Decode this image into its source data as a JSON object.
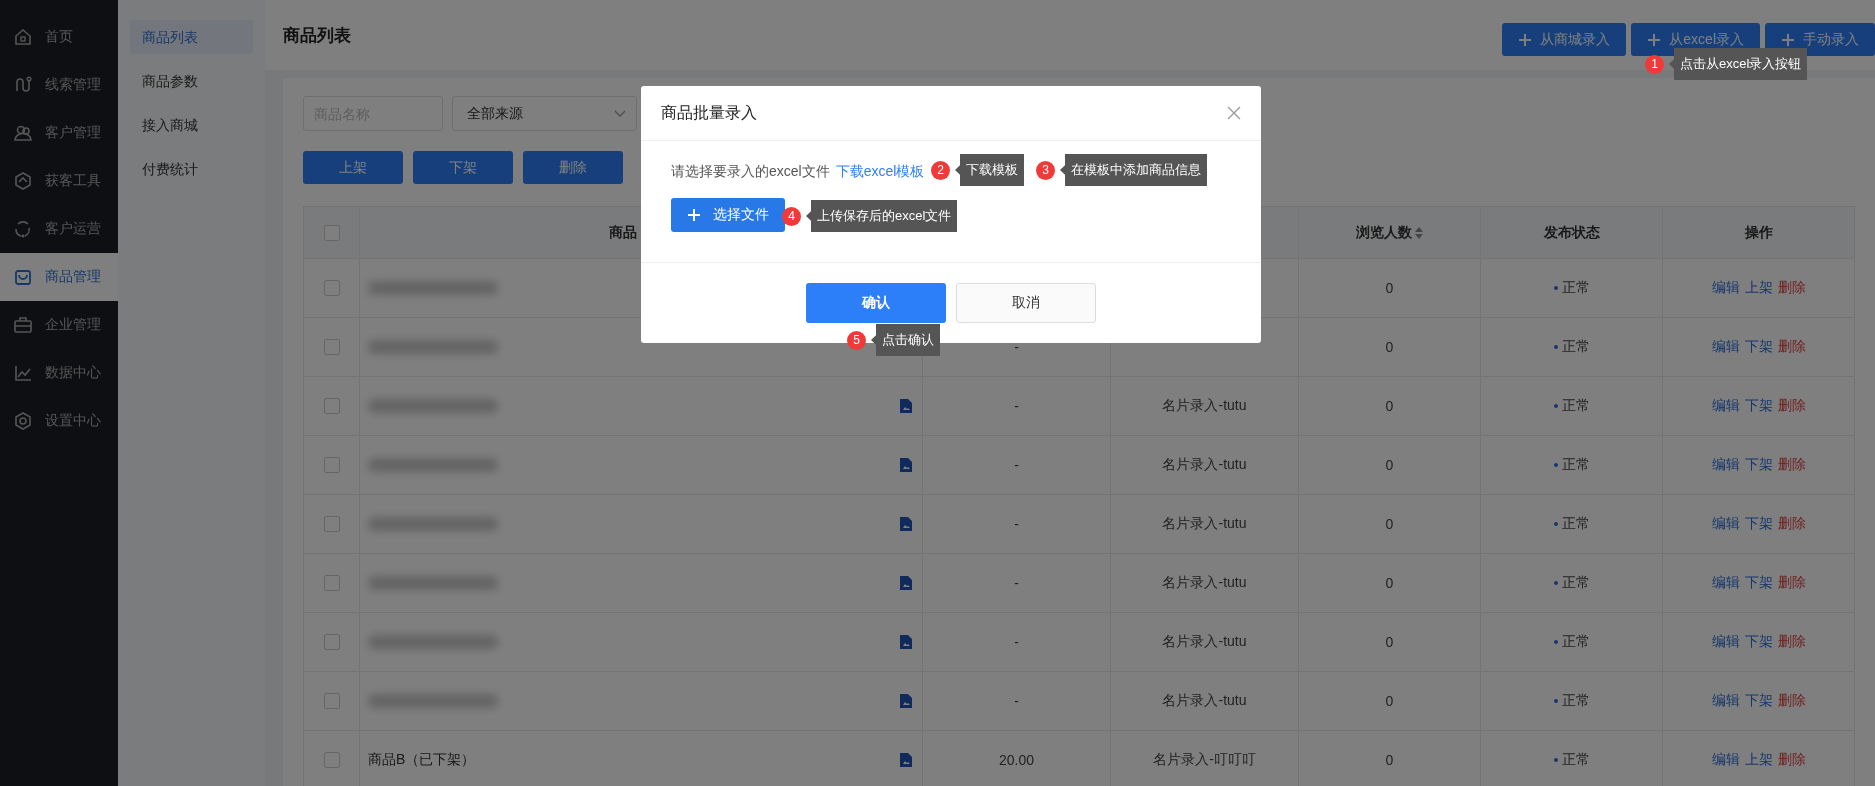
{
  "sidebar": {
    "items": [
      {
        "label": "首页",
        "selected": false
      },
      {
        "label": "线索管理",
        "selected": false
      },
      {
        "label": "客户管理",
        "selected": false
      },
      {
        "label": "获客工具",
        "selected": false
      },
      {
        "label": "客户运营",
        "selected": false
      },
      {
        "label": "商品管理",
        "selected": true
      },
      {
        "label": "企业管理",
        "selected": false
      },
      {
        "label": "数据中心",
        "selected": false
      },
      {
        "label": "设置中心",
        "selected": false
      }
    ]
  },
  "submenu": {
    "items": [
      {
        "label": "商品列表",
        "selected": true
      },
      {
        "label": "商品参数",
        "selected": false
      },
      {
        "label": "接入商城",
        "selected": false
      },
      {
        "label": "付费统计",
        "selected": false
      }
    ]
  },
  "page_title": "商品列表",
  "header_buttons": [
    "从商城录入",
    "从excel录入",
    "手动录入"
  ],
  "filters": {
    "name_field": {
      "placeholder": "商品名称"
    },
    "source_select": {
      "value": "全部来源"
    }
  },
  "bulk_buttons": [
    "上架",
    "下架",
    "删除"
  ],
  "table": {
    "select_all": {
      "checked": false
    },
    "columns": [
      {
        "kind": "name",
        "label": "商品"
      },
      {
        "kind": "column_2"
      },
      {
        "kind": "column_3"
      },
      {
        "kind": "count",
        "label": "浏览人数",
        "sortable": true
      },
      {
        "kind": "status",
        "label": "发布状态"
      },
      {
        "kind": "actions",
        "label": "操作"
      }
    ],
    "rows": [
      {
        "checked": false,
        "name_blurred": true,
        "views": "0",
        "status": "正常",
        "actions": [
          {
            "label": "编辑",
            "kind": "link"
          },
          {
            "label": "上架",
            "kind": "link"
          },
          {
            "label": "删除",
            "kind": "danger"
          }
        ]
      },
      {
        "checked": false,
        "name_blurred": true,
        "column_2": "-",
        "views": "0",
        "status": "正常",
        "actions": [
          {
            "label": "编辑",
            "kind": "link"
          },
          {
            "label": "下架",
            "kind": "link"
          },
          {
            "label": "删除",
            "kind": "danger"
          }
        ]
      },
      {
        "checked": false,
        "name_blurred": true,
        "image_icon": true,
        "column_2": "-",
        "column_3": "名片录入-tutu",
        "views": "0",
        "status": "正常",
        "actions": [
          {
            "label": "编辑",
            "kind": "link"
          },
          {
            "label": "下架",
            "kind": "link"
          },
          {
            "label": "删除",
            "kind": "danger"
          }
        ]
      },
      {
        "checked": false,
        "name_blurred": true,
        "image_icon": true,
        "column_2": "-",
        "column_3": "名片录入-tutu",
        "views": "0",
        "status": "正常",
        "actions": [
          {
            "label": "编辑",
            "kind": "link"
          },
          {
            "label": "下架",
            "kind": "link"
          },
          {
            "label": "删除",
            "kind": "danger"
          }
        ]
      },
      {
        "checked": false,
        "name_blurred": true,
        "image_icon": true,
        "column_2": "-",
        "column_3": "名片录入-tutu",
        "views": "0",
        "status": "正常",
        "actions": [
          {
            "label": "编辑",
            "kind": "link"
          },
          {
            "label": "下架",
            "kind": "link"
          },
          {
            "label": "删除",
            "kind": "danger"
          }
        ]
      },
      {
        "checked": false,
        "name_blurred": true,
        "image_icon": true,
        "column_2": "-",
        "column_3": "名片录入-tutu",
        "views": "0",
        "status": "正常",
        "actions": [
          {
            "label": "编辑",
            "kind": "link"
          },
          {
            "label": "下架",
            "kind": "link"
          },
          {
            "label": "删除",
            "kind": "danger"
          }
        ]
      },
      {
        "checked": false,
        "name_blurred": true,
        "image_icon": true,
        "column_2": "-",
        "column_3": "名片录入-tutu",
        "views": "0",
        "status": "正常",
        "actions": [
          {
            "label": "编辑",
            "kind": "link"
          },
          {
            "label": "下架",
            "kind": "link"
          },
          {
            "label": "删除",
            "kind": "danger"
          }
        ]
      },
      {
        "checked": false,
        "name_blurred": true,
        "image_icon": true,
        "column_2": "-",
        "column_3": "名片录入-tutu",
        "views": "0",
        "status": "正常",
        "actions": [
          {
            "label": "编辑",
            "kind": "link"
          },
          {
            "label": "下架",
            "kind": "link"
          },
          {
            "label": "删除",
            "kind": "danger"
          }
        ]
      },
      {
        "checked": false,
        "name": "商品B（已下架）",
        "image_icon": true,
        "column_2": "20.00",
        "column_3": "名片录入-叮叮叮",
        "views": "0",
        "status": "正常",
        "actions": [
          {
            "label": "编辑",
            "kind": "link"
          },
          {
            "label": "上架",
            "kind": "link"
          },
          {
            "label": "删除",
            "kind": "danger"
          }
        ]
      }
    ]
  },
  "modal": {
    "title": "商品批量录入",
    "prompt": "请选择要录入的excel文件",
    "template_link": "下载excel模板",
    "upload_button": "选择文件",
    "confirm_button": "确认",
    "cancel_button": "取消"
  },
  "annotations": [
    {
      "number": "1",
      "text": "点击从excel录入按钮"
    },
    {
      "number": "2",
      "text": "下载模板"
    },
    {
      "number": "3",
      "text": "在模板中添加商品信息"
    },
    {
      "number": "4",
      "text": "上传保存后的excel文件"
    },
    {
      "number": "5",
      "text": "点击确认"
    }
  ]
}
